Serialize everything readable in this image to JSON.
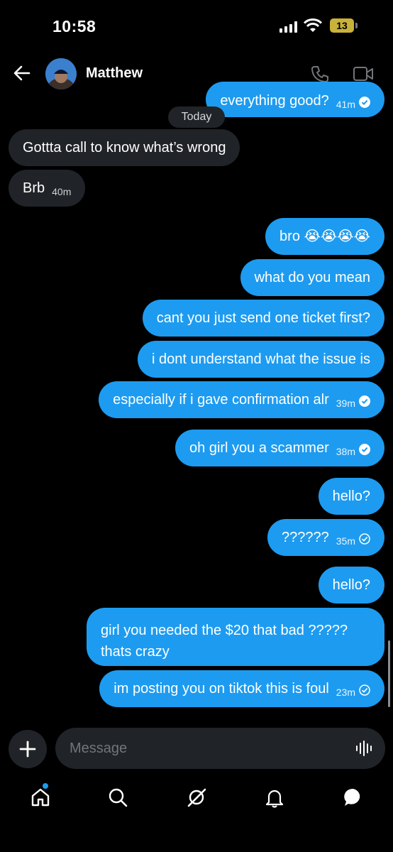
{
  "status_bar": {
    "time": "10:58",
    "battery": "13"
  },
  "header": {
    "contact_name": "Matthew"
  },
  "date_divider": "Today",
  "messages": [
    {
      "text": "everything good?",
      "time": "41m"
    },
    {
      "text": "Gottta call to know what’s wrong"
    },
    {
      "text": "Brb",
      "time": "40m"
    },
    {
      "text": "bro 😭😭😭😭"
    },
    {
      "text": "what do you mean"
    },
    {
      "text": "cant you just send one ticket first?"
    },
    {
      "text": "i dont understand what the issue is"
    },
    {
      "text": "especially if i gave confirmation alr",
      "time": "39m"
    },
    {
      "text": "oh girl you a scammer",
      "time": "38m"
    },
    {
      "text": "hello?"
    },
    {
      "text": "??????",
      "time": "35m"
    },
    {
      "text": "hello?"
    },
    {
      "text": "girl you needed the $20 that bad ?????",
      "text2": "thats crazy"
    },
    {
      "text": "im posting you on tiktok this is foul",
      "time": "23m"
    }
  ],
  "composer": {
    "placeholder": "Message"
  },
  "colors": {
    "accent": "#1d9bf0",
    "incoming_bubble": "#202327",
    "background": "#000000"
  },
  "icons": [
    "back-arrow-icon",
    "phone-icon",
    "video-camera-icon",
    "plus-icon",
    "voice-wave-icon",
    "home-icon",
    "search-icon",
    "grok-icon",
    "bell-icon",
    "messages-icon"
  ]
}
